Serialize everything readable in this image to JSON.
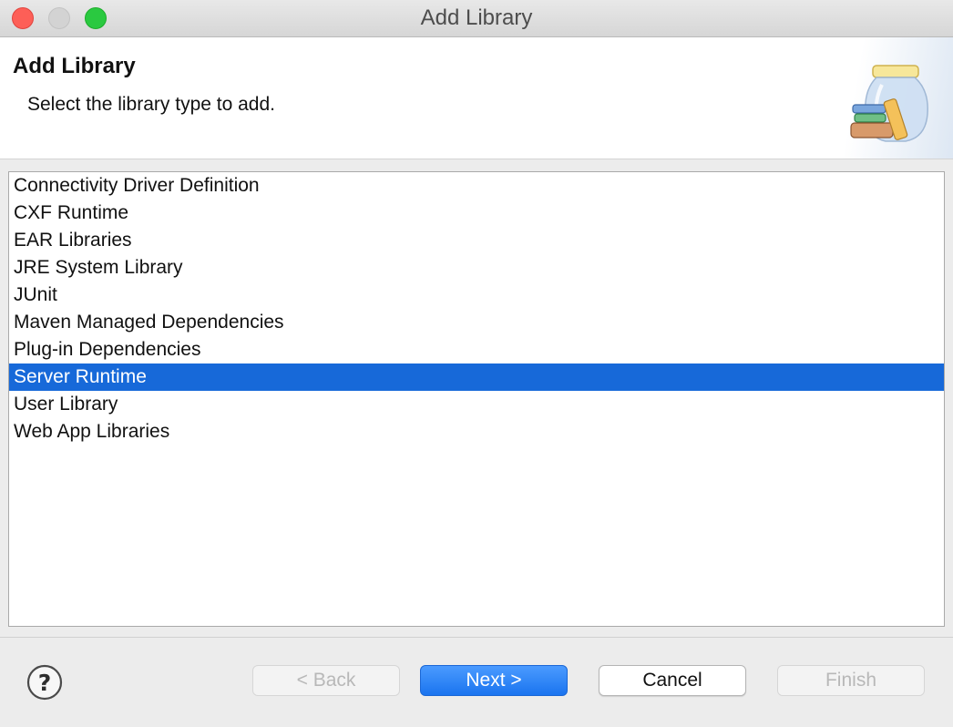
{
  "window": {
    "title": "Add Library"
  },
  "banner": {
    "title": "Add Library",
    "description": "Select the library type to add."
  },
  "library_types": [
    {
      "label": "Connectivity Driver Definition",
      "selected": false
    },
    {
      "label": "CXF Runtime",
      "selected": false
    },
    {
      "label": "EAR Libraries",
      "selected": false
    },
    {
      "label": "JRE System Library",
      "selected": false
    },
    {
      "label": "JUnit",
      "selected": false
    },
    {
      "label": "Maven Managed Dependencies",
      "selected": false
    },
    {
      "label": "Plug-in Dependencies",
      "selected": false
    },
    {
      "label": "Server Runtime",
      "selected": true
    },
    {
      "label": "User Library",
      "selected": false
    },
    {
      "label": "Web App Libraries",
      "selected": false
    }
  ],
  "buttons": {
    "back": {
      "label": "< Back",
      "enabled": false
    },
    "next": {
      "label": "Next >",
      "enabled": true,
      "default": true
    },
    "cancel": {
      "label": "Cancel",
      "enabled": true
    },
    "finish": {
      "label": "Finish",
      "enabled": false
    }
  },
  "icons": {
    "help": "help-icon",
    "banner": "library-jar-icon"
  },
  "colors": {
    "selection": "#1769d9",
    "default_button": "#1a74ef",
    "close": "#fd5f57",
    "maximize": "#2ac940"
  }
}
